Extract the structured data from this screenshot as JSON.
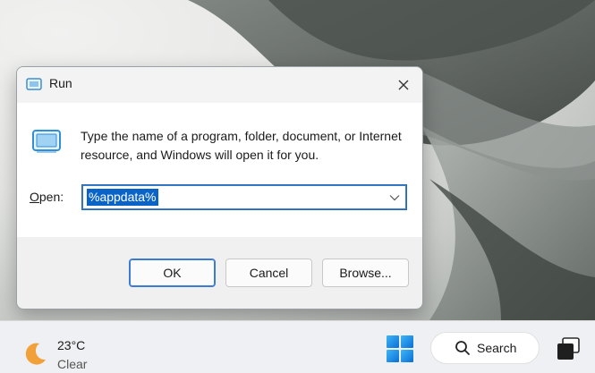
{
  "dialog": {
    "title": "Run",
    "description": "Type the name of a program, folder, document, or Internet resource, and Windows will open it for you.",
    "open_label_prefix": "O",
    "open_label_rest": "pen:",
    "open_value": "%appdata%",
    "buttons": {
      "ok": "OK",
      "cancel": "Cancel",
      "browse": "Browse..."
    }
  },
  "taskbar": {
    "weather": {
      "temperature": "23°C",
      "condition": "Clear",
      "icon": "moon-icon"
    },
    "search_label": "Search",
    "icons": [
      "windows-start-icon",
      "search-icon",
      "task-view-icon"
    ]
  },
  "colors": {
    "accent": "#0a64c8",
    "focus_border": "#3a7bd5",
    "taskbar_bg": "#eef0f3",
    "dialog_bg": "#f0f0f0"
  }
}
